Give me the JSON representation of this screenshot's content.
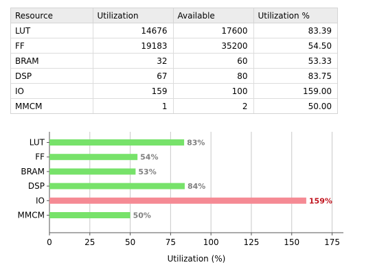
{
  "table": {
    "headers": [
      "Resource",
      "Utilization",
      "Available",
      "Utilization %"
    ],
    "rows": [
      [
        "LUT",
        "14676",
        "17600",
        "83.39"
      ],
      [
        "FF",
        "19183",
        "35200",
        "54.50"
      ],
      [
        "BRAM",
        "32",
        "60",
        "53.33"
      ],
      [
        "DSP",
        "67",
        "80",
        "83.75"
      ],
      [
        "IO",
        "159",
        "100",
        "159.00"
      ],
      [
        "MMCM",
        "1",
        "2",
        "50.00"
      ]
    ]
  },
  "chart_data": {
    "type": "bar",
    "orientation": "horizontal",
    "categories": [
      "LUT",
      "FF",
      "BRAM",
      "DSP",
      "IO",
      "MMCM"
    ],
    "values": [
      83.39,
      54.5,
      53.33,
      83.75,
      159.0,
      50.0
    ],
    "labels": [
      "83%",
      "54%",
      "53%",
      "84%",
      "159%",
      "50%"
    ],
    "xlabel": "Utilization (%)",
    "ylabel": "",
    "xlim": [
      0,
      182
    ],
    "xticks": [
      0,
      25,
      50,
      75,
      100,
      125,
      150,
      175
    ],
    "grid": "vertical",
    "colors": {
      "normal_bar": "#77e26a",
      "over_bar": "#f58a94",
      "normal_label": "#808080",
      "over_label": "#c0141e",
      "grid": "#c8c8c8",
      "axis": "#555555"
    }
  }
}
